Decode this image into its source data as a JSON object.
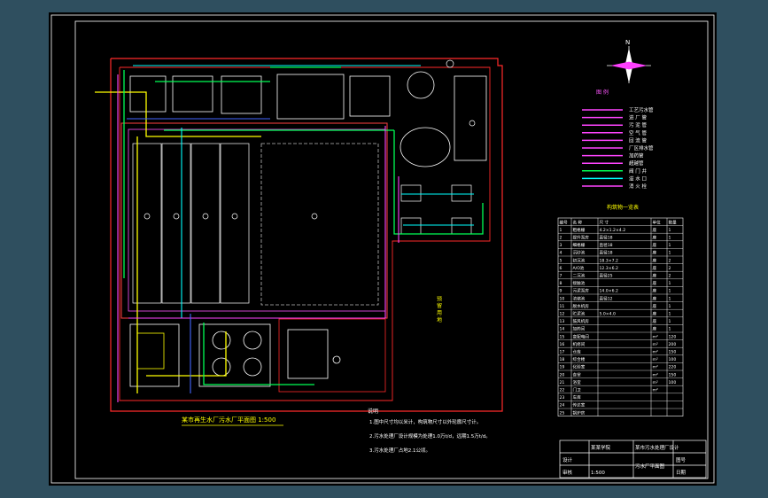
{
  "drawing": {
    "title": "某市再生水厂污水厂平面图 1:500",
    "north_label": "N",
    "legend_title": "图 例",
    "legend_items": [
      "工艺污水管",
      "进 厂 管",
      "污 泥 管",
      "空 气 管",
      "回 流 管",
      "厂区排水管",
      "加药管",
      "超越管",
      "阀 门 井",
      "溢 水 口",
      "消 火 栓"
    ],
    "table_title": "构筑物一览表",
    "table_headers": [
      "编号",
      "名 称",
      "尺 寸",
      "单位",
      "数量"
    ],
    "table_rows": [
      [
        "1",
        "粗格栅",
        "4.2×1.2×4.2",
        "座",
        "1"
      ],
      [
        "2",
        "提升泵房",
        "直径18",
        "座",
        "1"
      ],
      [
        "3",
        "细格栅",
        "直径18",
        "座",
        "1"
      ],
      [
        "4",
        "沉砂池",
        "直径18",
        "座",
        "1"
      ],
      [
        "5",
        "初沉池",
        "18.3×7.2",
        "座",
        "2"
      ],
      [
        "6",
        "A/O池",
        "12.3×6.2",
        "座",
        "2"
      ],
      [
        "7",
        "二沉池",
        "直径25",
        "座",
        "2"
      ],
      [
        "8",
        "接触池",
        "",
        "座",
        "1"
      ],
      [
        "9",
        "污泥泵房",
        "14.0×6.2",
        "座",
        "1"
      ],
      [
        "10",
        "浓缩池",
        "直径12",
        "座",
        "1"
      ],
      [
        "11",
        "脱水机房",
        "",
        "座",
        "1"
      ],
      [
        "12",
        "贮泥池",
        "5.0×4.0",
        "座",
        "1"
      ],
      [
        "13",
        "鼓风机房",
        "",
        "座",
        "1"
      ],
      [
        "14",
        "加药间",
        "",
        "座",
        "1"
      ],
      [
        "15",
        "变配电间",
        "",
        "m²",
        "120"
      ],
      [
        "16",
        "机修间",
        "",
        "m²",
        "200"
      ],
      [
        "17",
        "仓库",
        "",
        "m²",
        "150"
      ],
      [
        "18",
        "综合楼",
        "",
        "m²",
        "100"
      ],
      [
        "19",
        "化验室",
        "",
        "m²",
        "220"
      ],
      [
        "20",
        "食堂",
        "",
        "m²",
        "150"
      ],
      [
        "21",
        "浴室",
        "",
        "m²",
        "100"
      ],
      [
        "22",
        "门卫",
        "",
        "m²",
        ""
      ],
      [
        "23",
        "车库",
        "",
        "",
        ""
      ],
      [
        "24",
        "传达室",
        "",
        "",
        ""
      ],
      [
        "25",
        "锅炉房",
        "",
        "",
        ""
      ]
    ],
    "notes_title": "说明",
    "notes": [
      "1.图中尺寸均以米计，构筑物尺寸以外轮廓尺寸计。",
      "2.污水处理厂设计规模为处理1.0万t/d，远期1.5万t/d。",
      "3.污水处理厂占地2.1公顷。"
    ],
    "reserve_label": "预 留 用 地",
    "title_block": {
      "school": "某某学院",
      "project": "某市污水处理厂设计",
      "drawing_name": "污水厂平面图",
      "scale": "1:500",
      "design": "设计",
      "check": "审核",
      "drawing_no": "图号",
      "date": "日期"
    }
  }
}
